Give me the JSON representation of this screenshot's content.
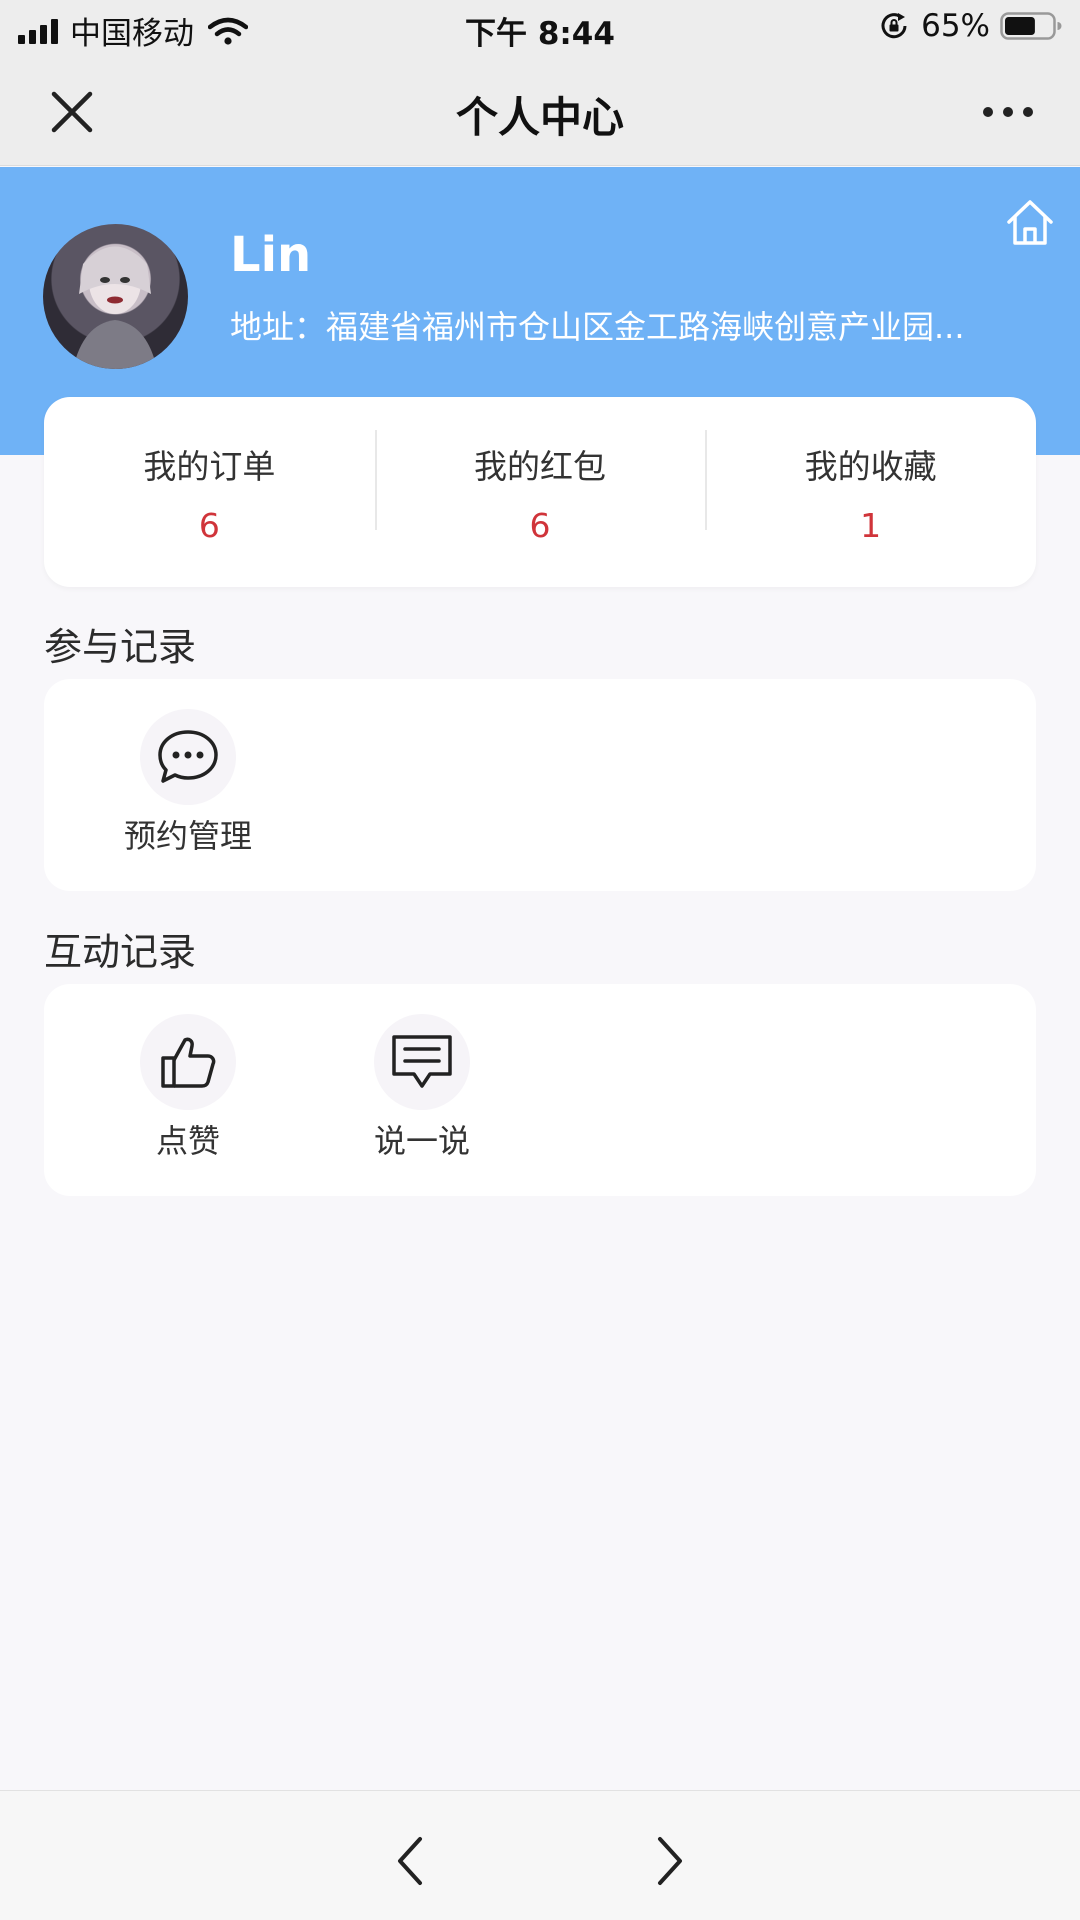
{
  "status_bar": {
    "carrier": "中国移动",
    "time": "下午 8:44",
    "battery": "65%",
    "battery_level": 0.65,
    "icons": [
      "signal-icon",
      "wifi-icon",
      "orientation-lock-icon",
      "battery-icon"
    ]
  },
  "nav": {
    "title": "个人中心",
    "icons": [
      "close-icon",
      "more-icon"
    ]
  },
  "profile": {
    "name": "Lin",
    "address": "地址：福建省福州市仓山区金工路海峡创意产业园...",
    "icons": [
      "avatar",
      "home-icon"
    ]
  },
  "stats": [
    {
      "label": "我的订单",
      "value": "6"
    },
    {
      "label": "我的红包",
      "value": "6"
    },
    {
      "label": "我的收藏",
      "value": "1"
    }
  ],
  "participation": {
    "title": "参与记录",
    "items": [
      {
        "label": "预约管理",
        "icon": "chat-bubble-icon"
      }
    ]
  },
  "interaction": {
    "title": "互动记录",
    "items": [
      {
        "label": "点赞",
        "icon": "thumbs-up-icon"
      },
      {
        "label": "说一说",
        "icon": "message-icon"
      }
    ]
  },
  "bottom_nav": {
    "icons": [
      "back-arrow-icon",
      "forward-arrow-icon"
    ]
  },
  "colors": {
    "header_blue": "#6fb2f6",
    "stat_value_red": "#d0343a",
    "background": "#f8f7fa"
  }
}
